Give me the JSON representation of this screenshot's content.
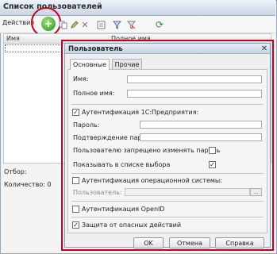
{
  "window": {
    "title": "Список пользователей",
    "toolbar": {
      "actions_label": "Действия"
    },
    "columns": [
      "Имя",
      "Полное имя"
    ],
    "footer": {
      "select_label": "Отбор:",
      "count_label": "Количество: 0"
    }
  },
  "dialog": {
    "title": "Пользователь",
    "tabs": [
      {
        "label": "Основные",
        "active": true
      },
      {
        "label": "Прочие",
        "active": false
      }
    ],
    "fields": {
      "name_label": "Имя:",
      "name_value": "",
      "fullname_label": "Полное имя:",
      "fullname_value": ""
    },
    "auth_1c": {
      "label": "Аутентификация 1С:Предприятия:",
      "checked": true,
      "password_label": "Пароль:",
      "confirm_label": "Подтверждение пароля:",
      "forbid_change_label": "Пользователю запрещено изменять пароль",
      "forbid_change_checked": false,
      "show_in_list_label": "Показывать в списке выбора",
      "show_in_list_checked": true
    },
    "auth_os": {
      "label": "Аутентификация операционной системы:",
      "checked": false,
      "user_label": "Пользователь:",
      "pick_button": "..."
    },
    "auth_openid": {
      "label": "Аутентификация OpenID",
      "checked": false
    },
    "protection": {
      "label": "Защита от опасных действий",
      "checked": true
    },
    "buttons": {
      "ok": "OK",
      "cancel": "Отмена",
      "help": "Справка"
    }
  },
  "icons": {
    "add": "add-icon",
    "copy": "copy-icon",
    "edit": "edit-icon",
    "delete": "delete-icon",
    "list": "list-icon",
    "filter": "filter-icon",
    "refresh": "refresh-icon"
  },
  "colors": {
    "highlight_outline": "#c40022",
    "add_icon": "#3a9c2a"
  }
}
